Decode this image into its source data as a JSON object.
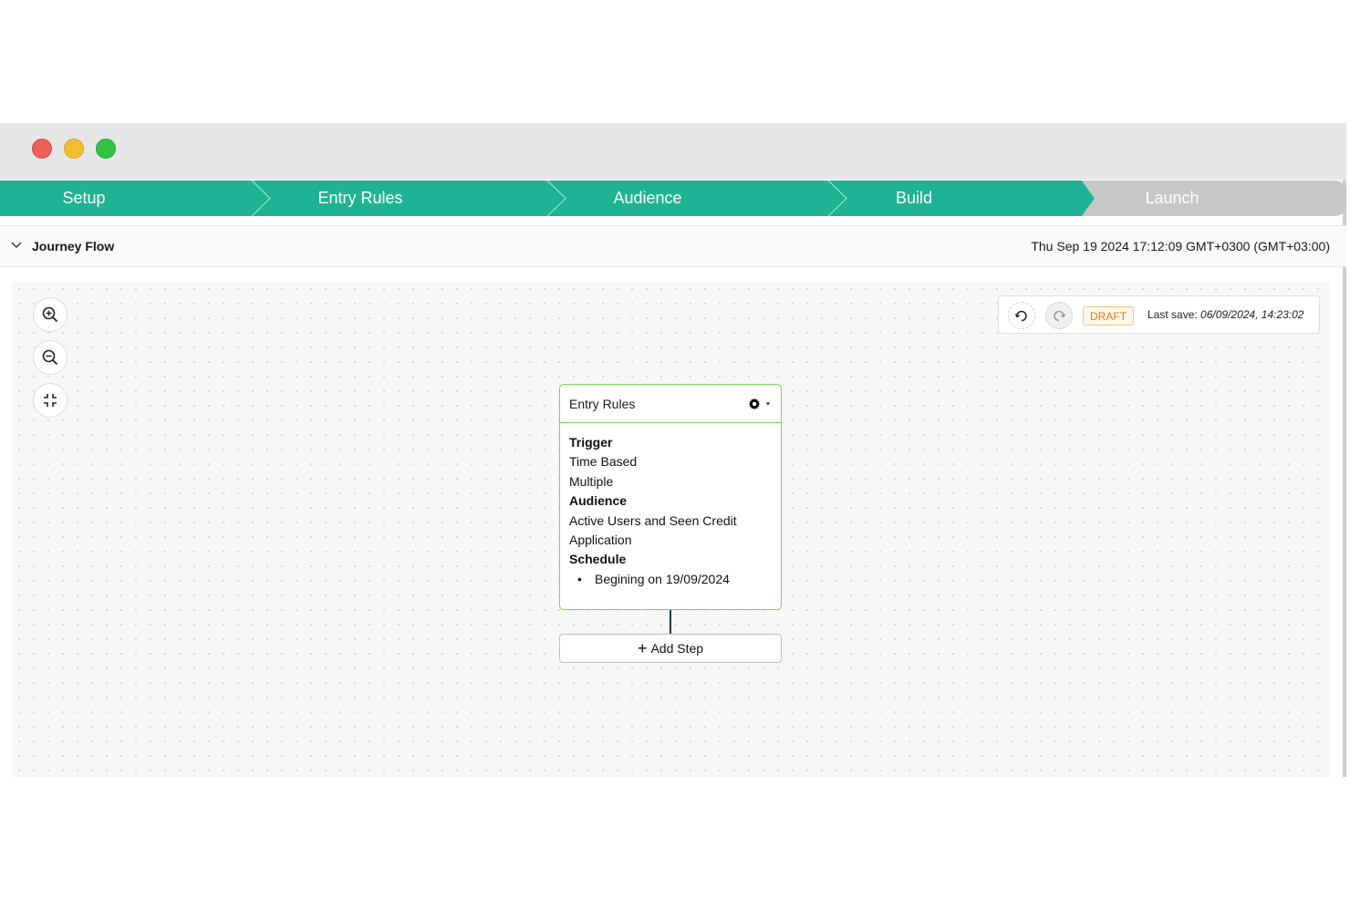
{
  "window": {
    "traffic_lights": [
      "close",
      "minimize",
      "maximize"
    ]
  },
  "stepper": {
    "steps": [
      {
        "label": "Setup",
        "state": "complete"
      },
      {
        "label": "Entry Rules",
        "state": "complete"
      },
      {
        "label": "Audience",
        "state": "complete"
      },
      {
        "label": "Build",
        "state": "complete"
      },
      {
        "label": "Launch",
        "state": "pending"
      }
    ],
    "colors": {
      "complete": "#1db394",
      "pending": "#c7c7c7"
    }
  },
  "flow_header": {
    "toggle_icon": "chevron-down-icon",
    "title": "Journey Flow",
    "datetime": "Thu Sep 19 2024 17:12:09 GMT+0300 (GMT+03:00)"
  },
  "toolbar": {
    "zoom_in_icon": "zoom-in-icon",
    "zoom_out_icon": "zoom-out-icon",
    "fit_icon": "fit-view-icon"
  },
  "save_status": {
    "undo_icon": "undo-icon",
    "redo_icon": "redo-icon",
    "status_badge": "DRAFT",
    "last_save_label": "Last save:",
    "last_save_value": "06/09/2024, 14:23:02"
  },
  "entry_card": {
    "title": "Entry Rules",
    "settings_icon": "gear-icon",
    "trigger_heading": "Trigger",
    "trigger_type": "Time Based",
    "trigger_frequency": "Multiple",
    "audience_heading": "Audience",
    "audience_line1": "Active Users and Seen Credit",
    "audience_line2": "Application",
    "schedule_heading": "Schedule",
    "schedule_items": [
      "Begining on 19/09/2024"
    ]
  },
  "add_step": {
    "label": "Add Step",
    "icon": "plus-icon"
  }
}
